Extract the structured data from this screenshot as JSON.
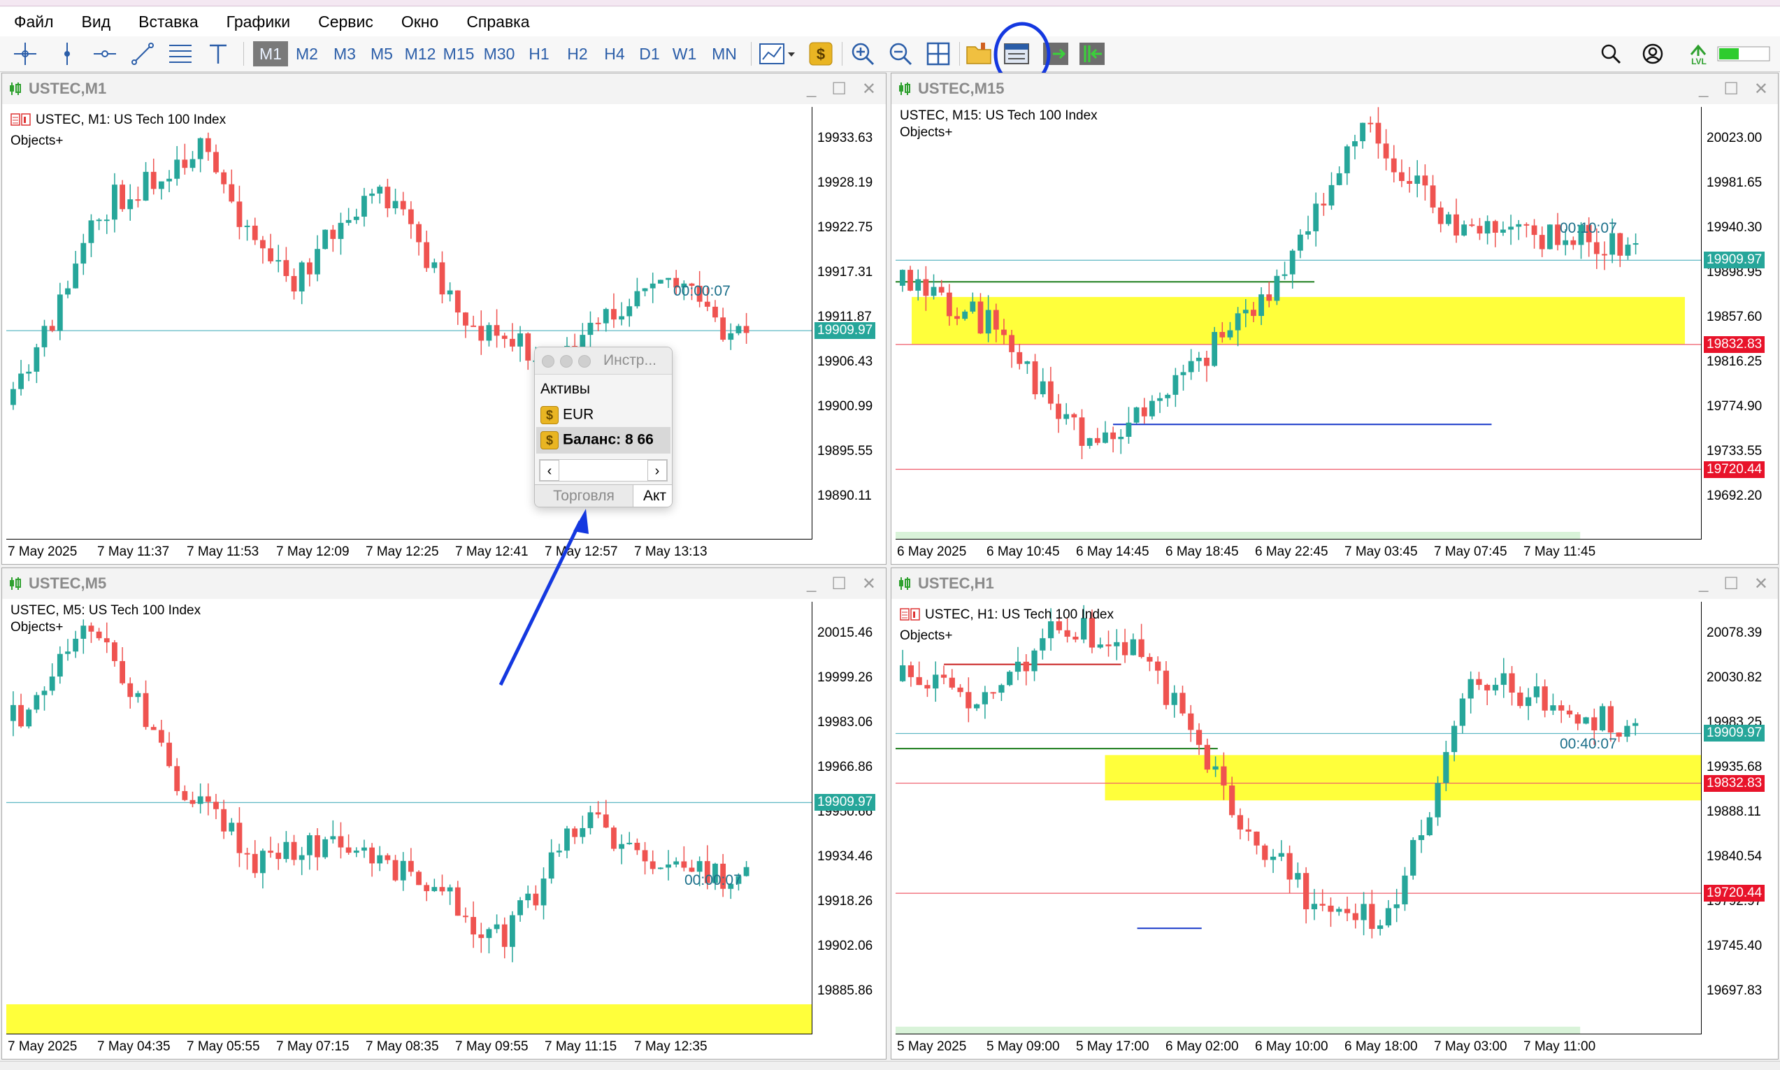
{
  "menu": [
    "Файл",
    "Вид",
    "Вставка",
    "Графики",
    "Сервис",
    "Окно",
    "Справка"
  ],
  "timeframes": [
    "M1",
    "M2",
    "M3",
    "M5",
    "M12",
    "M15",
    "M30",
    "H1",
    "H2",
    "H4",
    "D1",
    "W1",
    "MN"
  ],
  "active_timeframe": "M1",
  "toolbar_icons": [
    "crosshair-icon",
    "vertical-line-icon",
    "horizontal-line-icon",
    "trend-line-icon",
    "fibonacci-icon",
    "text-icon",
    "chart-type-icon",
    "dollar-icon",
    "zoom-in-icon",
    "zoom-out-icon",
    "tile-windows-icon",
    "open-folder-icon",
    "market-panel-icon",
    "autoscroll-icon",
    "chart-shift-icon",
    "search-icon",
    "account-icon",
    "lvl-icon",
    "signal-bar-icon"
  ],
  "lvl_label": "LVL",
  "colors": {
    "bull": "#26a69a",
    "bear": "#ef5350",
    "zone": "#ffff3b",
    "price_tag_current": "#26a69a",
    "price_tag_red": "#e8132a",
    "highlight_circle": "#1438e0",
    "arrow": "#1438e0"
  },
  "windows": [
    {
      "id": "m1",
      "title": "USTEC,M1",
      "info": "USTEC, M1:  US Tech 100 Index",
      "objects": "Objects+",
      "yticks": [
        "19933.63",
        "19928.19",
        "19922.75",
        "19917.31",
        "19911.87",
        "19906.43",
        "19900.99",
        "19895.55",
        "19890.11"
      ],
      "current_price": "19909.97",
      "timer": "00:00:07",
      "red_tags": [],
      "xlabels": [
        "7 May 2025",
        "7 May 11:37",
        "7 May 11:53",
        "7 May 12:09",
        "7 May 12:25",
        "7 May 12:41",
        "7 May 12:57",
        "7 May 13:13"
      ]
    },
    {
      "id": "m15",
      "title": "USTEC,M15",
      "info": "USTEC, M15:  US Tech 100 Index",
      "objects": "Objects+",
      "yticks": [
        "20023.00",
        "19981.65",
        "19940.30",
        "19898.95",
        "19857.60",
        "19816.25",
        "19774.90",
        "19733.55",
        "19692.20"
      ],
      "current_price": "19909.97",
      "timer": "00:10:07",
      "red_tags": [
        "19832.83",
        "19720.44"
      ],
      "xlabels": [
        "6 May 2025",
        "6 May 10:45",
        "6 May 14:45",
        "6 May 18:45",
        "6 May 22:45",
        "7 May 03:45",
        "7 May 07:45",
        "7 May 11:45"
      ]
    },
    {
      "id": "m5",
      "title": "USTEC,M5",
      "info": "USTEC, M5:  US Tech 100 Index",
      "objects": "Objects+",
      "yticks": [
        "20015.46",
        "19999.26",
        "19983.06",
        "19966.86",
        "19950.66",
        "19934.46",
        "19918.26",
        "19902.06",
        "19885.86"
      ],
      "current_price": "19909.97",
      "timer": "00:00:07",
      "red_tags": [],
      "xlabels": [
        "7 May 2025",
        "7 May 04:35",
        "7 May 05:55",
        "7 May 07:15",
        "7 May 08:35",
        "7 May 09:55",
        "7 May 11:15",
        "7 May 12:35"
      ]
    },
    {
      "id": "h1",
      "title": "USTEC,H1",
      "info": "USTEC, H1:  US Tech 100 Index",
      "objects": "Objects+",
      "yticks": [
        "20078.39",
        "20030.82",
        "19983.25",
        "19935.68",
        "19888.11",
        "19840.54",
        "19792.97",
        "19745.40",
        "19697.83"
      ],
      "current_price": "19909.97",
      "timer": "00:40:07",
      "red_tags": [
        "19832.83",
        "19720.44"
      ],
      "xlabels": [
        "5 May 2025",
        "5 May 09:00",
        "5 May 17:00",
        "6 May 02:00",
        "6 May 10:00",
        "6 May 18:00",
        "7 May 03:00",
        "7 May 11:00"
      ]
    }
  ],
  "popup": {
    "title": "Инстр...",
    "section": "Активы",
    "asset": "EUR",
    "balance": "Баланс: 8 66",
    "tab_trade": "Торговля",
    "tab_assets": "Акт"
  }
}
